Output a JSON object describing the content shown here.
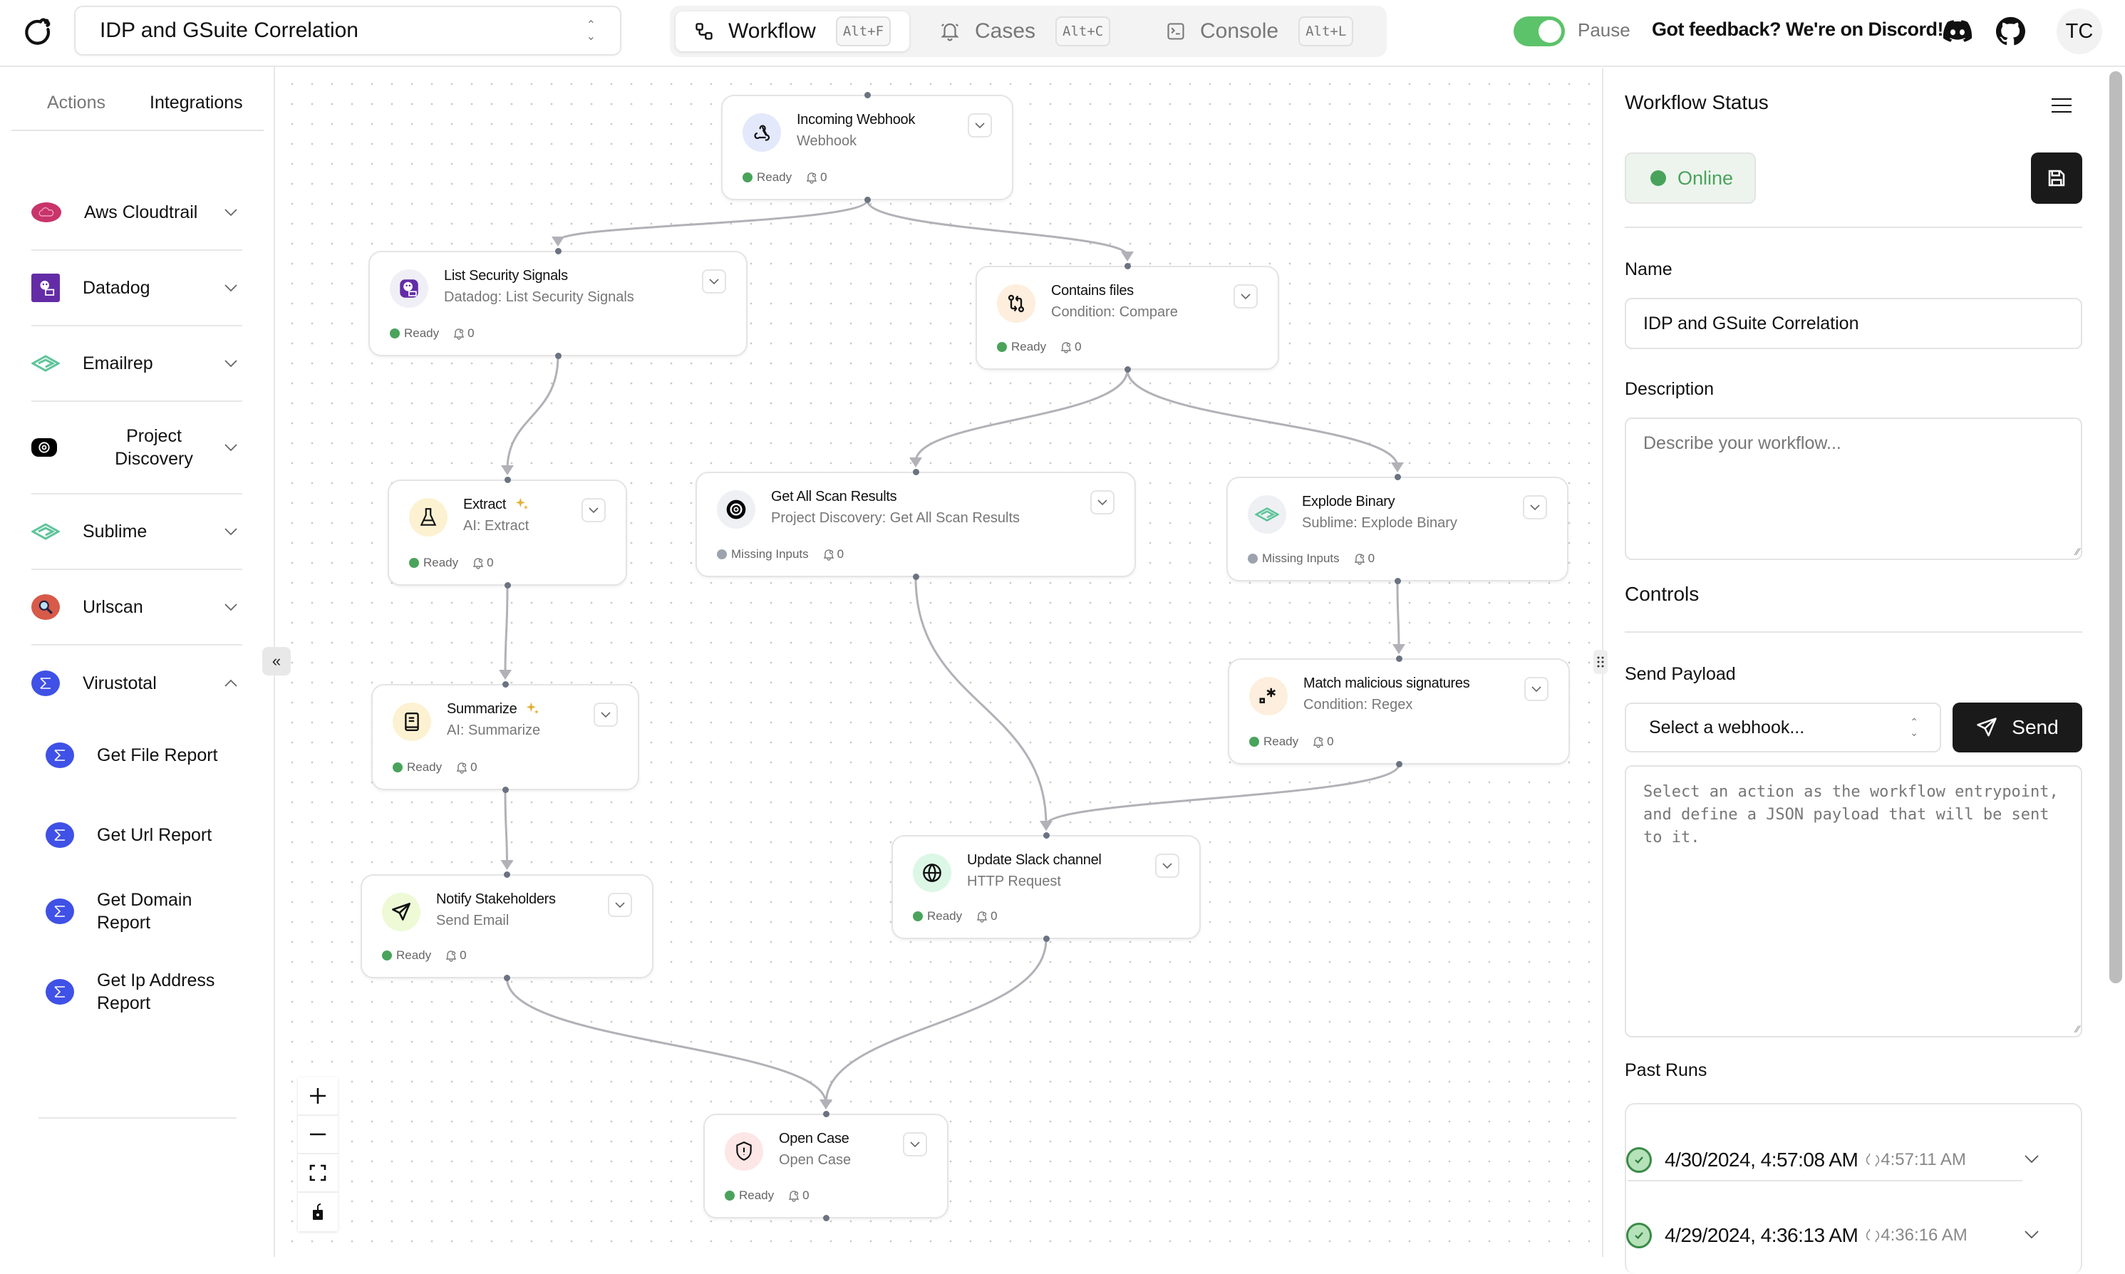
{
  "topbar": {
    "workflow_select": "IDP and GSuite Correlation",
    "tabs": [
      {
        "label": "Workflow",
        "shortcut": "Alt+F",
        "active": true,
        "icon": "workflow-icon"
      },
      {
        "label": "Cases",
        "shortcut": "Alt+C",
        "active": false,
        "icon": "bell-icon"
      },
      {
        "label": "Console",
        "shortcut": "Alt+L",
        "active": false,
        "icon": "terminal-icon"
      }
    ],
    "pause_label": "Pause",
    "pause_toggle_on": true,
    "feedback": "Got feedback? We're on Discord!",
    "avatar_initials": "TC"
  },
  "sidebar": {
    "tabs": [
      {
        "label": "Actions",
        "active": false
      },
      {
        "label": "Integrations",
        "active": true
      }
    ],
    "integrations": [
      {
        "label": "Aws Cloudtrail",
        "icon": "aws-cloudtrail-icon",
        "expanded": false
      },
      {
        "label": "Datadog",
        "icon": "datadog-icon",
        "expanded": false
      },
      {
        "label": "Emailrep",
        "icon": "emailrep-icon",
        "expanded": false
      },
      {
        "label": "Project Discovery",
        "icon": "project-discovery-icon",
        "expanded": false
      },
      {
        "label": "Sublime",
        "icon": "sublime-icon",
        "expanded": false
      },
      {
        "label": "Urlscan",
        "icon": "urlscan-icon",
        "expanded": false
      },
      {
        "label": "Virustotal",
        "icon": "virustotal-icon",
        "expanded": true,
        "children": [
          "Get File Report",
          "Get Url Report",
          "Get Domain Report",
          "Get Ip Address Report"
        ]
      }
    ]
  },
  "canvas": {
    "nodes": [
      {
        "id": "webhook",
        "title": "Incoming Webhook",
        "subtitle": "Webhook",
        "status": "Ready",
        "alerts": "0",
        "icon": "webhook-icon",
        "ai": false
      },
      {
        "id": "list_signals",
        "title": "List Security Signals",
        "subtitle": "Datadog: List Security Signals",
        "status": "Ready",
        "alerts": "0",
        "icon": "datadog-icon",
        "ai": false
      },
      {
        "id": "contains_files",
        "title": "Contains files",
        "subtitle": "Condition: Compare",
        "status": "Ready",
        "alerts": "0",
        "icon": "compare-icon",
        "ai": false
      },
      {
        "id": "extract",
        "title": "Extract",
        "subtitle": "AI: Extract",
        "status": "Ready",
        "alerts": "0",
        "icon": "flask-icon",
        "ai": true
      },
      {
        "id": "scan_results",
        "title": "Get All Scan Results",
        "subtitle": "Project Discovery: Get All Scan Results",
        "status": "Missing Inputs",
        "alerts": "0",
        "icon": "project-discovery-icon",
        "ai": false
      },
      {
        "id": "explode",
        "title": "Explode Binary",
        "subtitle": "Sublime: Explode Binary",
        "status": "Missing Inputs",
        "alerts": "0",
        "icon": "sublime-icon",
        "ai": false
      },
      {
        "id": "summarize",
        "title": "Summarize",
        "subtitle": "AI: Summarize",
        "status": "Ready",
        "alerts": "0",
        "icon": "book-icon",
        "ai": true
      },
      {
        "id": "match",
        "title": "Match malicious signatures",
        "subtitle": "Condition: Regex",
        "status": "Ready",
        "alerts": "0",
        "icon": "regex-icon",
        "ai": false
      },
      {
        "id": "slack",
        "title": "Update Slack channel",
        "subtitle": "HTTP Request",
        "status": "Ready",
        "alerts": "0",
        "icon": "globe-icon",
        "ai": false
      },
      {
        "id": "notify",
        "title": "Notify Stakeholders",
        "subtitle": "Send Email",
        "status": "Ready",
        "alerts": "0",
        "icon": "send-icon",
        "ai": false
      },
      {
        "id": "open_case",
        "title": "Open Case",
        "subtitle": "Open Case",
        "status": "Ready",
        "alerts": "0",
        "icon": "shield-alert-icon",
        "ai": false
      }
    ],
    "edges": [
      [
        "webhook",
        "list_signals"
      ],
      [
        "webhook",
        "contains_files"
      ],
      [
        "list_signals",
        "extract"
      ],
      [
        "extract",
        "summarize"
      ],
      [
        "summarize",
        "notify"
      ],
      [
        "contains_files",
        "scan_results"
      ],
      [
        "contains_files",
        "explode"
      ],
      [
        "explode",
        "match"
      ],
      [
        "scan_results",
        "slack"
      ],
      [
        "match",
        "slack"
      ],
      [
        "notify",
        "open_case"
      ],
      [
        "slack",
        "open_case"
      ]
    ],
    "status_colors": {
      "Ready": "#4aa35b",
      "Missing Inputs": "#9ca3af"
    }
  },
  "panel": {
    "title": "Workflow Status",
    "status": "Online",
    "name_label": "Name",
    "name_value": "IDP and GSuite Correlation",
    "description_label": "Description",
    "description_placeholder": "Describe your workflow...",
    "controls_title": "Controls",
    "send_payload_label": "Send Payload",
    "webhook_select": "Select a webhook...",
    "send_label": "Send",
    "payload_placeholder": "Select an action as the workflow entrypoint, and define a JSON payload that will be sent to it.",
    "past_runs_label": "Past Runs",
    "runs": [
      {
        "start": "4/30/2024, 4:57:08 AM",
        "end": "4:57:11 AM",
        "status": "success"
      },
      {
        "start": "4/29/2024, 4:36:13 AM",
        "end": "4:36:16 AM",
        "status": "success"
      }
    ]
  }
}
